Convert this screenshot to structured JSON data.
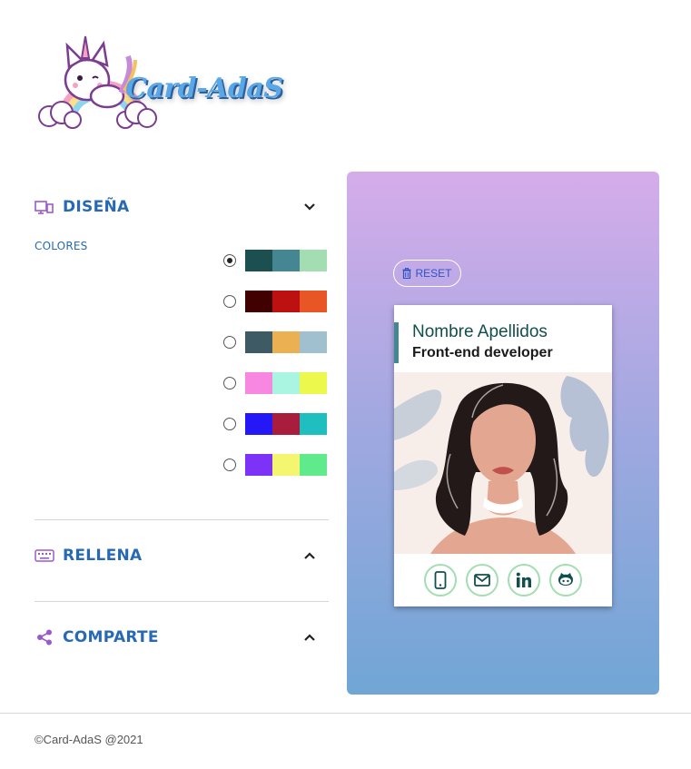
{
  "header": {
    "logo_text": "Card-AdaS",
    "logo_icon": "unicorn-cat-rainbow-logo"
  },
  "design": {
    "title": "DISEÑA",
    "icon": "design-icon",
    "expanded": true,
    "colors_label": "COLORES",
    "palettes": [
      {
        "selected": true,
        "colors": [
          "#1c4f50",
          "#448691",
          "#a2deb1"
        ]
      },
      {
        "selected": false,
        "colors": [
          "#420101",
          "#bd1010",
          "#e95626"
        ]
      },
      {
        "selected": false,
        "colors": [
          "#3e5b65",
          "#eab052",
          "#a0c0cf"
        ]
      },
      {
        "selected": false,
        "colors": [
          "#f887e1",
          "#aaf5e1",
          "#ecf94c"
        ]
      },
      {
        "selected": false,
        "colors": [
          "#2418f7",
          "#a81d3b",
          "#20bfbf"
        ]
      },
      {
        "selected": false,
        "colors": [
          "#7d32f7",
          "#f4f670",
          "#5fea8b"
        ]
      }
    ]
  },
  "fill": {
    "title": "RELLENA",
    "icon": "keyboard-icon",
    "expanded": false
  },
  "share": {
    "title": "COMPARTE",
    "icon": "share-icon",
    "expanded": false
  },
  "preview": {
    "reset_label": "RESET",
    "reset_icon": "trash-icon",
    "card": {
      "name": "Nombre Apellidos",
      "job": "Front-end developer",
      "accent_color": "#438792",
      "social": [
        {
          "icon": "mobile-icon"
        },
        {
          "icon": "email-icon"
        },
        {
          "icon": "linkedin-icon"
        },
        {
          "icon": "github-icon"
        }
      ]
    }
  },
  "footer": {
    "copyright": "©Card-AdaS @2021"
  }
}
